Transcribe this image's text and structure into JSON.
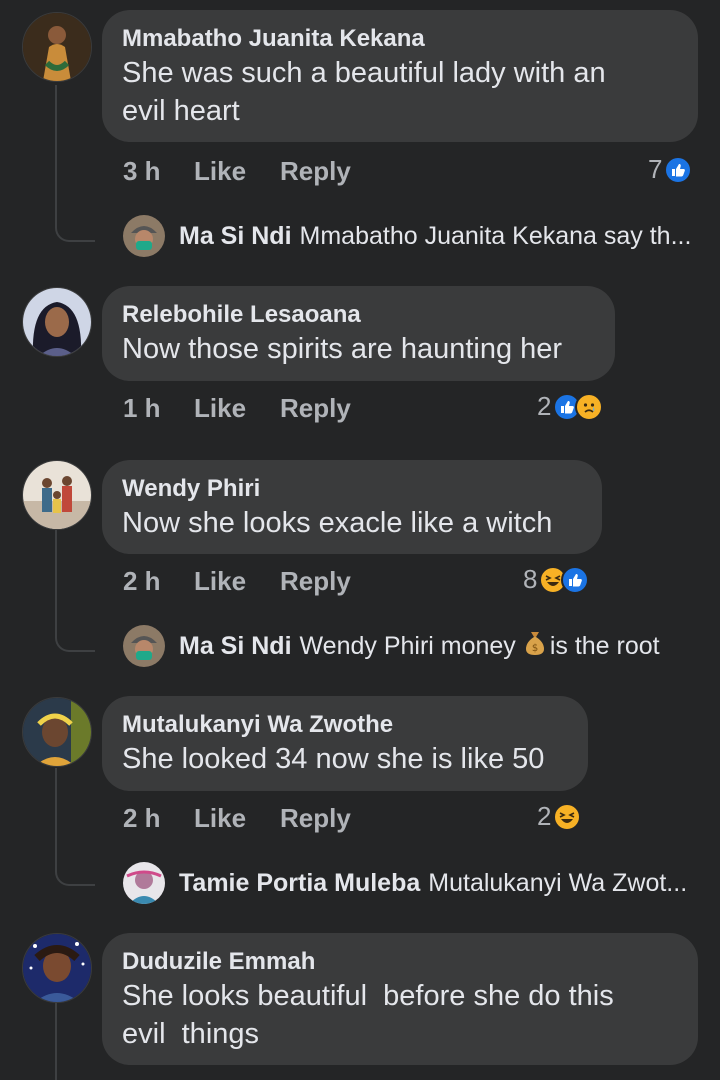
{
  "comments": [
    {
      "author": "Mmabatho Juanita Kekana",
      "text_lines": [
        "She was such a beautiful lady with an",
        "evil heart"
      ],
      "time": "3 h",
      "like": "Like",
      "reply": "Reply",
      "reaction_count": "7",
      "reply_preview": {
        "author": "Ma Si Ndi",
        "text": "Mmabatho Juanita Kekana say th..."
      }
    },
    {
      "author": "Relebohile Lesaoana",
      "text_lines": [
        "Now those spirits are haunting her"
      ],
      "time": "1 h",
      "like": "Like",
      "reply": "Reply",
      "reaction_count": "2"
    },
    {
      "author": "Wendy Phiri",
      "text_lines": [
        "Now she looks exacle like a witch"
      ],
      "time": "2 h",
      "like": "Like",
      "reply": "Reply",
      "reaction_count": "8",
      "reply_preview": {
        "author": "Ma Si Ndi",
        "text_before": "Wendy Phiri money",
        "text_after": "is the root"
      }
    },
    {
      "author": "Mutalukanyi Wa Zwothe",
      "text_lines": [
        "She looked 34 now she is like 50"
      ],
      "time": "2 h",
      "like": "Like",
      "reply": "Reply",
      "reaction_count": "2",
      "reply_preview": {
        "author": "Tamie Portia Muleba",
        "text": "Mutalukanyi Wa Zwot..."
      }
    },
    {
      "author": "Duduzile Emmah",
      "text_lines": [
        "She looks beautiful  before she do this",
        "evil  things"
      ]
    }
  ],
  "colors": {
    "background": "#242526",
    "bubble": "#3a3b3c",
    "like_blue": "#1b74e4",
    "emoji_yellow": "#f7b125"
  }
}
